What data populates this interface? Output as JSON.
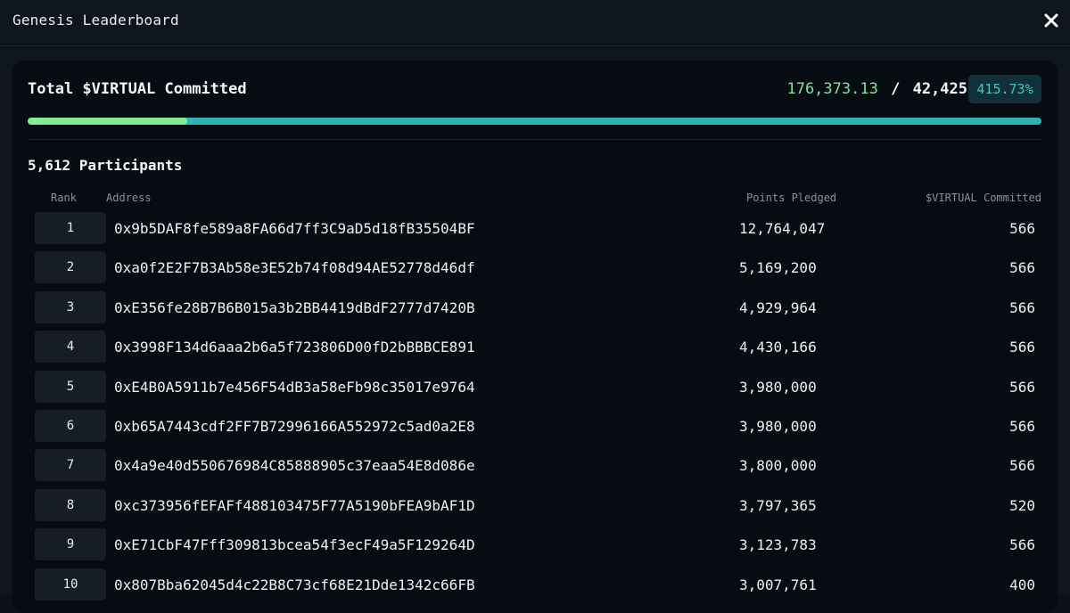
{
  "modal": {
    "title": "Genesis Leaderboard"
  },
  "summary": {
    "label": "Total $VIRTUAL Committed",
    "committed": "176,373.13",
    "separator": "/",
    "target": "42,425",
    "percent": "415.73%",
    "progress_fraction": 0.157
  },
  "participants_label": "5,612 Participants",
  "table": {
    "columns": [
      "Rank",
      "Address",
      "Points Pledged",
      "$VIRTUAL Committed"
    ],
    "rows": [
      {
        "rank": "1",
        "address": "0x9b5DAF8fe589a8FA66d7ff3C9aD5d18fB35504BF",
        "points": "12,764,047",
        "virtual": "566"
      },
      {
        "rank": "2",
        "address": "0xa0f2E2F7B3Ab58e3E52b74f08d94AE52778d46df",
        "points": "5,169,200",
        "virtual": "566"
      },
      {
        "rank": "3",
        "address": "0xE356fe28B7B6B015a3b2BB4419dBdF2777d7420B",
        "points": "4,929,964",
        "virtual": "566"
      },
      {
        "rank": "4",
        "address": "0x3998F134d6aaa2b6a5f723806D00fD2bBBBCE891",
        "points": "4,430,166",
        "virtual": "566"
      },
      {
        "rank": "5",
        "address": "0xE4B0A5911b7e456F54dB3a58eFb98c35017e9764",
        "points": "3,980,000",
        "virtual": "566"
      },
      {
        "rank": "6",
        "address": "0xb65A7443cdf2FF7B72996166A552972c5ad0a2E8",
        "points": "3,980,000",
        "virtual": "566"
      },
      {
        "rank": "7",
        "address": "0x4a9e40d550676984C85888905c37eaa54E8d086e",
        "points": "3,800,000",
        "virtual": "566"
      },
      {
        "rank": "8",
        "address": "0xc373956fEFAFf488103475F77A5190bFEA9bAF1D",
        "points": "3,797,365",
        "virtual": "520"
      },
      {
        "rank": "9",
        "address": "0xE71CbF47Fff309813bcea54f3ecF49a5F129264D",
        "points": "3,123,783",
        "virtual": "566"
      },
      {
        "rank": "10",
        "address": "0x807Bba62045d4c22B8C73cf68E21Dde1342c66FB",
        "points": "3,007,761",
        "virtual": "400"
      }
    ]
  },
  "icons": {
    "close": "close-icon"
  },
  "colors": {
    "committed": "#7de69a",
    "percent": "#3fc7c4",
    "progress_fill": "#84ec94",
    "progress_track": "#30b3b4"
  }
}
